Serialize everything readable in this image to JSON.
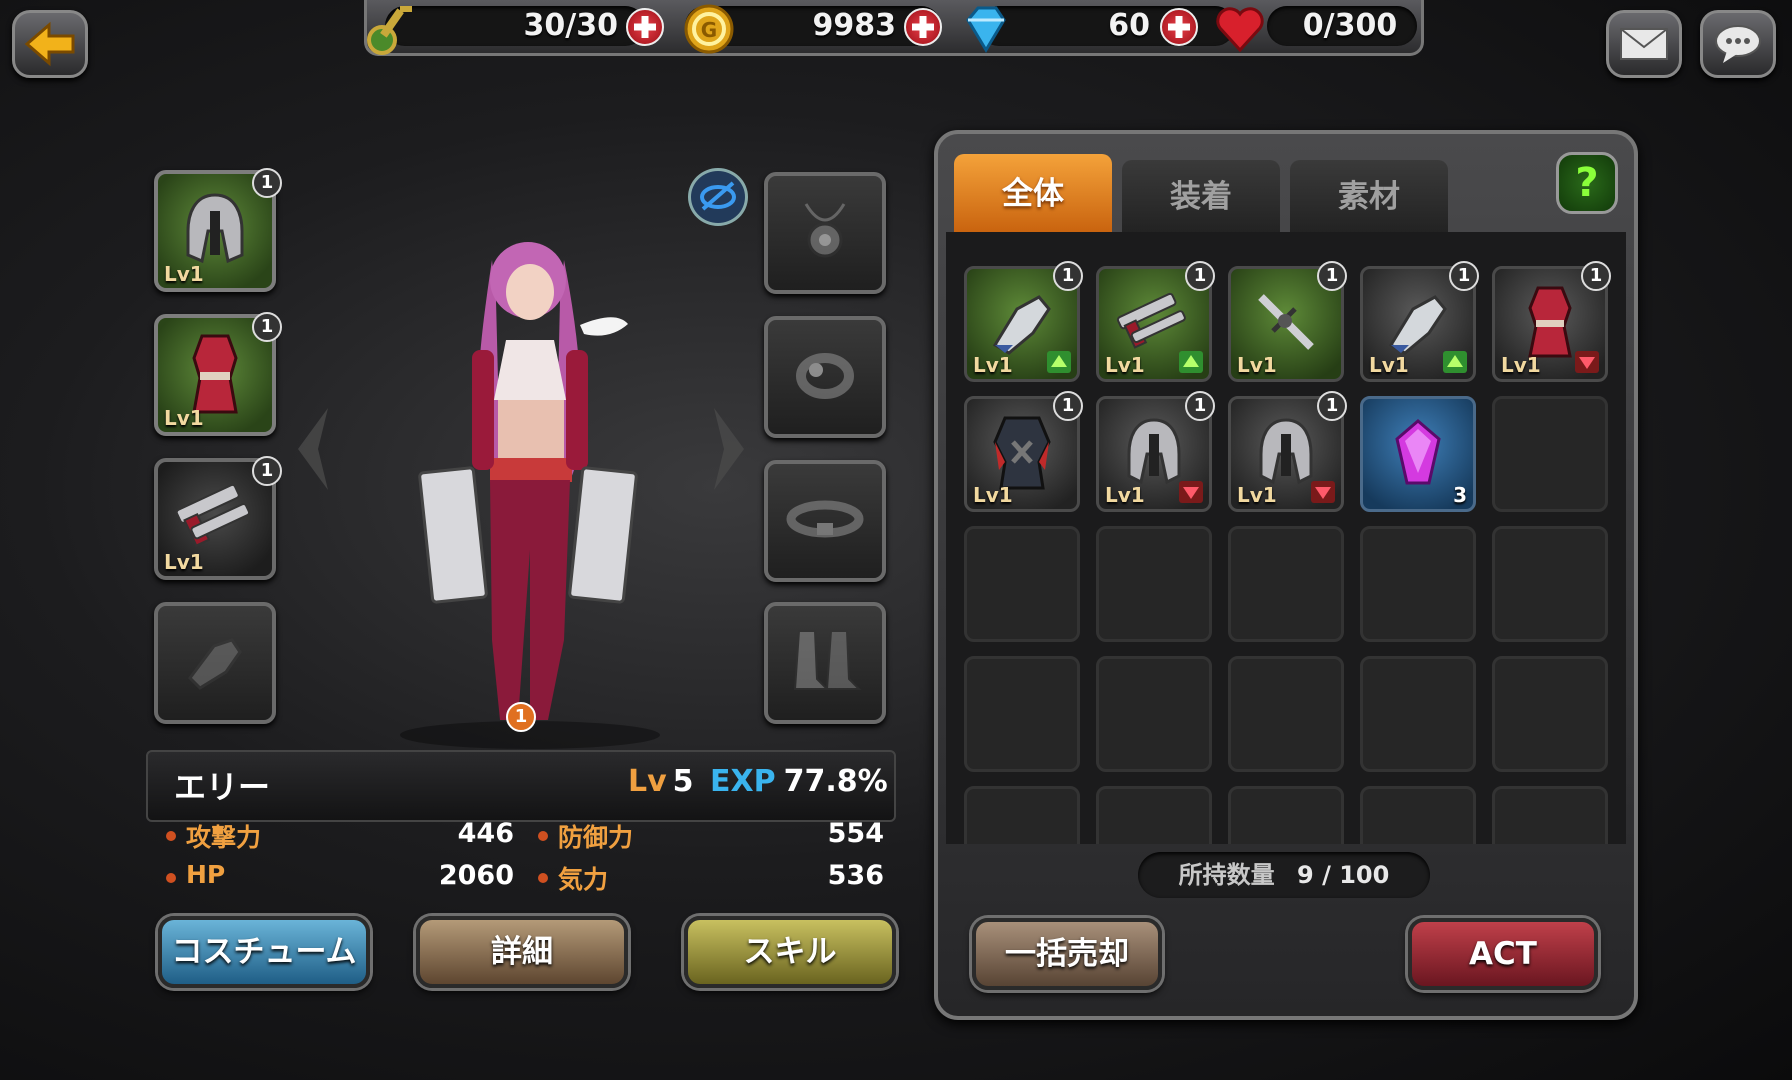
{
  "topbar": {
    "keys": "30/30",
    "gold": "9983",
    "gems": "60",
    "hearts": "0/300"
  },
  "character": {
    "name": "エリー",
    "level_prefix": "Lv",
    "level": "5",
    "exp_label": "EXP",
    "exp_value": "77.8%",
    "costume_badge": "1"
  },
  "stats": [
    {
      "label": "攻撃力",
      "value": "446"
    },
    {
      "label": "防御力",
      "value": "554"
    },
    {
      "label": "HP",
      "value": "2060"
    },
    {
      "label": "気力",
      "value": "536"
    }
  ],
  "equip_left": [
    {
      "name": "helmet",
      "level": "Lv1",
      "badge": "1"
    },
    {
      "name": "armor",
      "level": "Lv1",
      "badge": "1"
    },
    {
      "name": "pistols",
      "level": "Lv1",
      "badge": "1"
    },
    {
      "name": "glove-empty",
      "level": "",
      "badge": ""
    }
  ],
  "buttons": {
    "costume": "コスチューム",
    "detail": "詳細",
    "skill": "スキル",
    "bulk_sell": "一括売却",
    "act": "ACT"
  },
  "tabs": [
    "全体",
    "装着",
    "素材"
  ],
  "help": "?",
  "inventory": {
    "count_label": "所持数量",
    "count_value": "9 / 100",
    "items": [
      {
        "kind": "gauntlet",
        "bg": "green",
        "level": "Lv1",
        "badge": "1",
        "arrow": "up"
      },
      {
        "kind": "pistols",
        "bg": "green",
        "level": "Lv1",
        "badge": "1",
        "arrow": "up"
      },
      {
        "kind": "sword",
        "bg": "green",
        "level": "Lv1",
        "badge": "1",
        "arrow": ""
      },
      {
        "kind": "gauntlet",
        "bg": "gray",
        "level": "Lv1",
        "badge": "1",
        "arrow": "up"
      },
      {
        "kind": "armor",
        "bg": "gray",
        "level": "Lv1",
        "badge": "1",
        "arrow": "down"
      },
      {
        "kind": "dark-armor",
        "bg": "gray",
        "level": "Lv1",
        "badge": "1",
        "arrow": ""
      },
      {
        "kind": "helmet",
        "bg": "gray",
        "level": "Lv1",
        "badge": "1",
        "arrow": "down"
      },
      {
        "kind": "helmet",
        "bg": "gray",
        "level": "Lv1",
        "badge": "1",
        "arrow": "down"
      },
      {
        "kind": "gem",
        "bg": "blue",
        "level": "",
        "badge": "",
        "qty": "3"
      }
    ]
  }
}
